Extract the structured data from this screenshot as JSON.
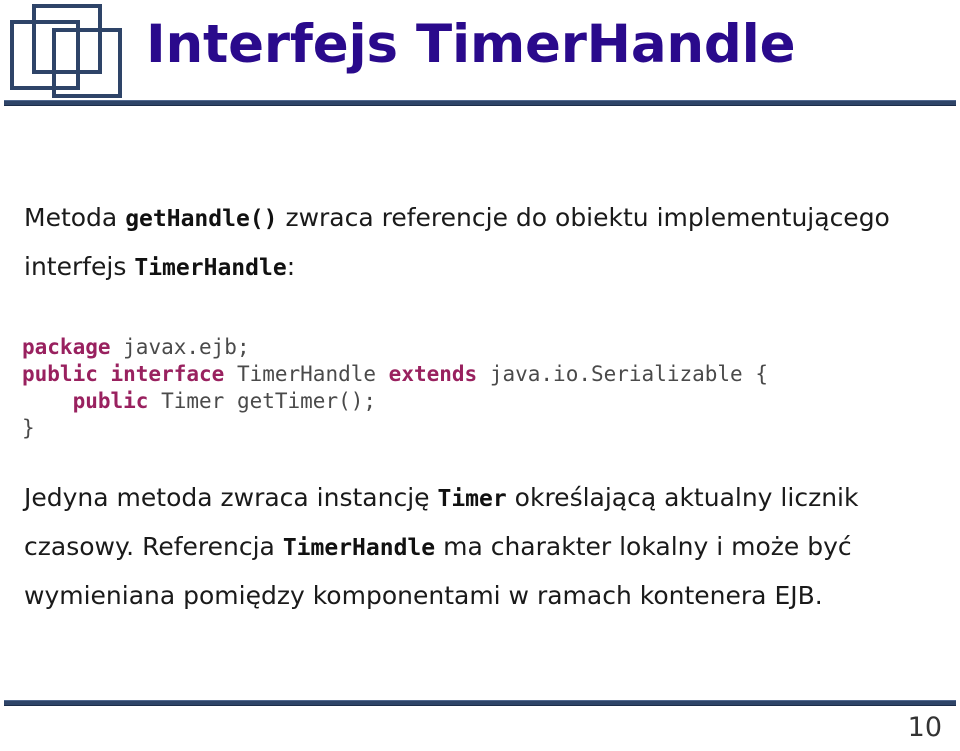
{
  "slide": {
    "title": "Interfejs TimerHandle",
    "page_number": "10",
    "colors": {
      "title": "#2A0A8C",
      "rule": "#2E4468",
      "code_keyword": "#99215F",
      "code_plain": "#4A4A4A",
      "body_text": "#1A1A1A",
      "background": "#FFFFFF"
    }
  },
  "logo": {
    "name": "three-overlapping-squares-logo"
  },
  "paragraph_top": {
    "line1": {
      "seg1": "Metoda ",
      "code1": "getHandle()",
      "seg2": " zwraca referencje do obiektu implementującego"
    },
    "line2": {
      "seg1": "interfejs ",
      "code1": "TimerHandle",
      "seg2": ":"
    }
  },
  "code_block": {
    "lines": [
      [
        {
          "t": "package",
          "k": true
        },
        {
          "t": " javax.ejb;",
          "k": false
        }
      ],
      [
        {
          "t": "public interface",
          "k": true
        },
        {
          "t": " TimerHandle ",
          "k": false
        },
        {
          "t": "extends",
          "k": true
        },
        {
          "t": " java.io.Serializable {",
          "k": false
        }
      ],
      [
        {
          "t": "    ",
          "k": false
        },
        {
          "t": "public",
          "k": true
        },
        {
          "t": " Timer getTimer();",
          "k": false
        }
      ],
      [
        {
          "t": "}",
          "k": false
        }
      ]
    ]
  },
  "paragraph_bottom": {
    "line1": {
      "seg1": "Jedyna metoda zwraca instancję ",
      "code1": "Timer",
      "seg2": " określającą aktualny licznik"
    },
    "line2": {
      "seg1": "czasowy. Referencja ",
      "code1": "TimerHandle",
      "seg2": " ma charakter lokalny i może być"
    },
    "line3": {
      "seg1": "wymieniana pomiędzy komponentami w ramach kontenera EJB."
    }
  }
}
